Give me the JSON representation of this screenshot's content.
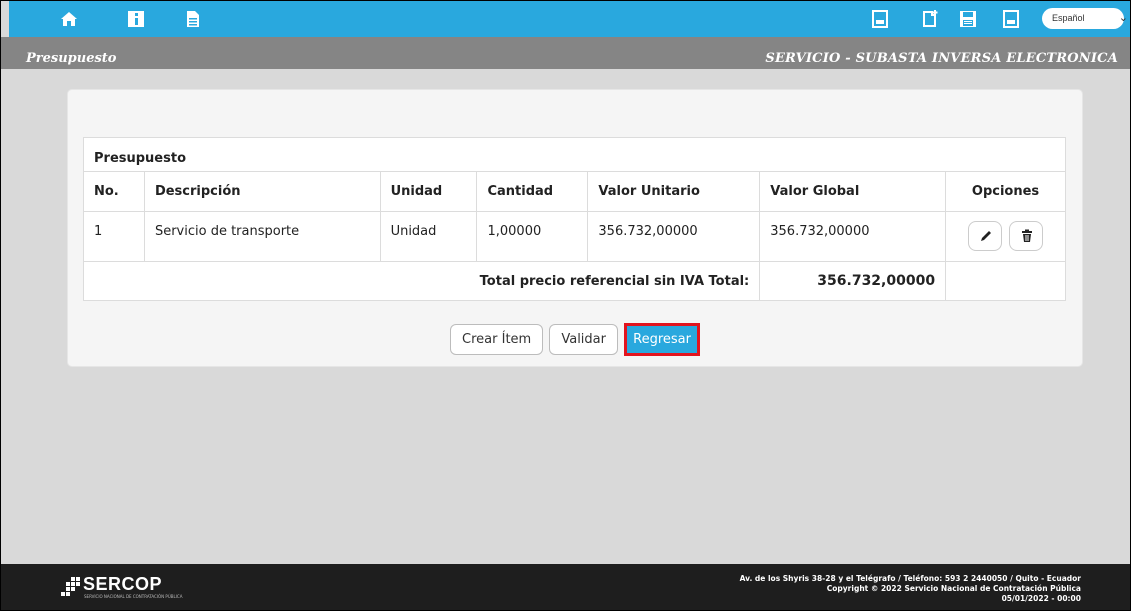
{
  "toolbar": {
    "left_icons": [
      "home-icon",
      "info-icon",
      "document-icon"
    ],
    "right_icons": [
      "pdf-icon",
      "new-document-icon",
      "save-icon",
      "pdf-export-icon"
    ],
    "language": "Español",
    "accent": "#29a8de"
  },
  "titlebar": {
    "left": "Presupuesto",
    "right": "SERVICIO - SUBASTA INVERSA ELECTRONICA"
  },
  "table": {
    "caption": "Presupuesto",
    "headers": [
      "No.",
      "Descripción",
      "Unidad",
      "Cantidad",
      "Valor Unitario",
      "Valor Global",
      "Opciones"
    ],
    "rows": [
      {
        "no": "1",
        "descripcion": "Servicio de transporte",
        "unidad": "Unidad",
        "cantidad": "1,00000",
        "valor_unitario": "356.732,00000",
        "valor_global": "356.732,00000"
      }
    ],
    "total_label": "Total precio referencial sin IVA Total:",
    "total_value": "356.732,00000"
  },
  "buttons": {
    "create": "Crear Ítem",
    "validate": "Validar",
    "back": "Regresar"
  },
  "footer": {
    "logo": "SERCOP",
    "logo_tagline": "SERVICIO NACIONAL DE CONTRATACIÓN PÚBLICA",
    "address": "Av. de los Shyris 38-28 y el Telégrafo / Teléfono: 593 2 2440050 / Quito - Ecuador",
    "copyright": "Copyright © 2022 Servicio Nacional de Contratación Pública",
    "date": "05/01/2022 - 00:00"
  }
}
